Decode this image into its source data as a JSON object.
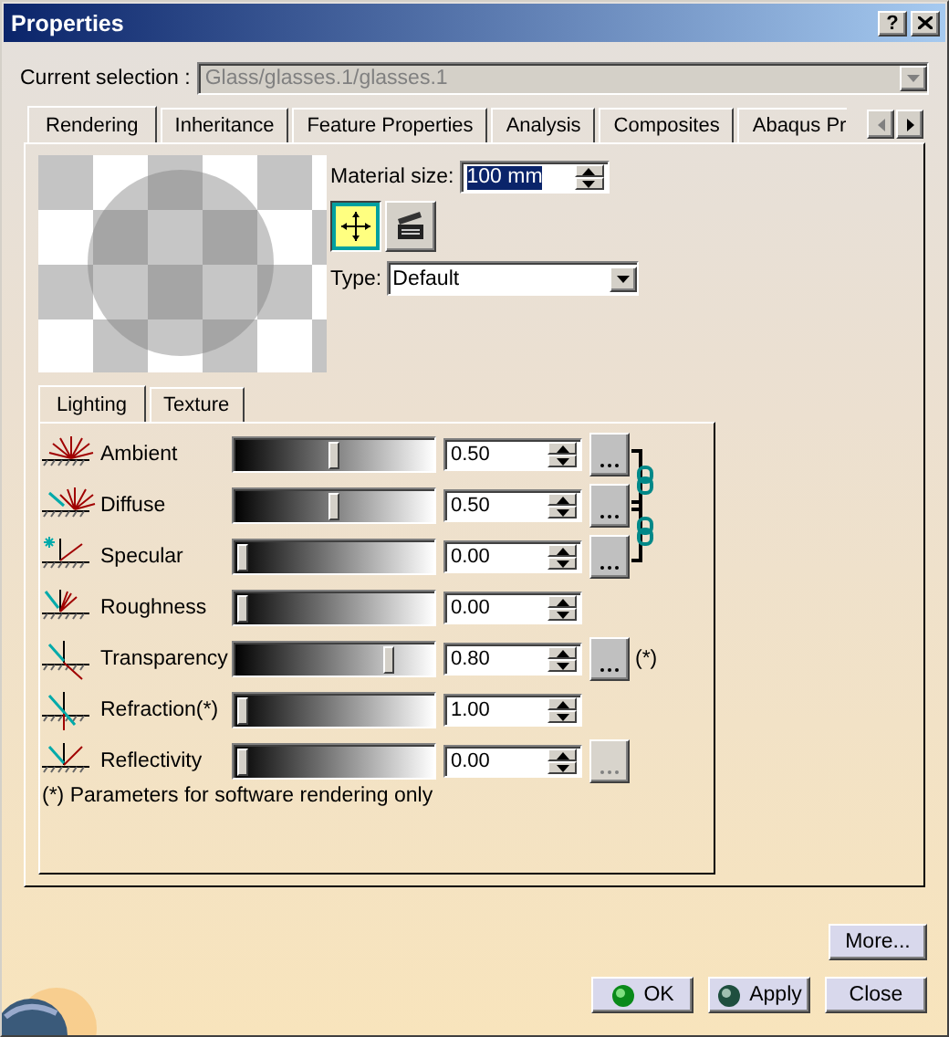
{
  "window": {
    "title": "Properties",
    "help": "?"
  },
  "current_selection": {
    "label": "Current selection :",
    "value": "Glass/glasses.1/glasses.1",
    "disabled": true
  },
  "tabs": [
    {
      "label": "Rendering",
      "selected": true
    },
    {
      "label": "Inheritance",
      "selected": false
    },
    {
      "label": "Feature Properties",
      "selected": false
    },
    {
      "label": "Analysis",
      "selected": false
    },
    {
      "label": "Composites",
      "selected": false
    },
    {
      "label": "Abaqus Pr",
      "selected": false
    }
  ],
  "material_size": {
    "label": "Material size:",
    "value": "100 mm",
    "value_selected": true
  },
  "tool_buttons": [
    {
      "kind": "fit",
      "pressed": true
    },
    {
      "kind": "clapper",
      "pressed": false
    }
  ],
  "type": {
    "label": "Type:",
    "value": "Default"
  },
  "subtabs": [
    {
      "label": "Lighting",
      "selected": true
    },
    {
      "label": "Texture",
      "selected": false
    }
  ],
  "properties": [
    {
      "name": "Ambient",
      "level": 0.5,
      "value": "0.50",
      "color_button": true,
      "color_button_disabled": false,
      "linked": true
    },
    {
      "name": "Diffuse",
      "level": 0.5,
      "value": "0.50",
      "color_button": true,
      "color_button_disabled": false,
      "linked": true
    },
    {
      "name": "Specular",
      "level": 0,
      "value": "0.00",
      "color_button": true,
      "color_button_disabled": false,
      "linked": false
    },
    {
      "name": "Roughness",
      "level": 0,
      "value": "0.00",
      "color_button": false,
      "linked": false
    },
    {
      "name": "Transparency",
      "level": 0.8,
      "value": "0.80",
      "color_button": true,
      "color_button_disabled": false,
      "linked": false,
      "note": "(*)"
    },
    {
      "name": "Refraction(*)",
      "level": 0,
      "value": "1.00",
      "color_button": false,
      "linked": false
    },
    {
      "name": "Reflectivity",
      "level": 0,
      "value": "0.00",
      "color_button": true,
      "color_button_disabled": true,
      "linked": false
    }
  ],
  "footnote": "(*) Parameters for software rendering only",
  "more_button": "More...",
  "buttons": [
    {
      "label": "OK",
      "kind": "ok"
    },
    {
      "label": "Apply",
      "kind": "apply"
    },
    {
      "label": "Close",
      "kind": "plain"
    }
  ]
}
